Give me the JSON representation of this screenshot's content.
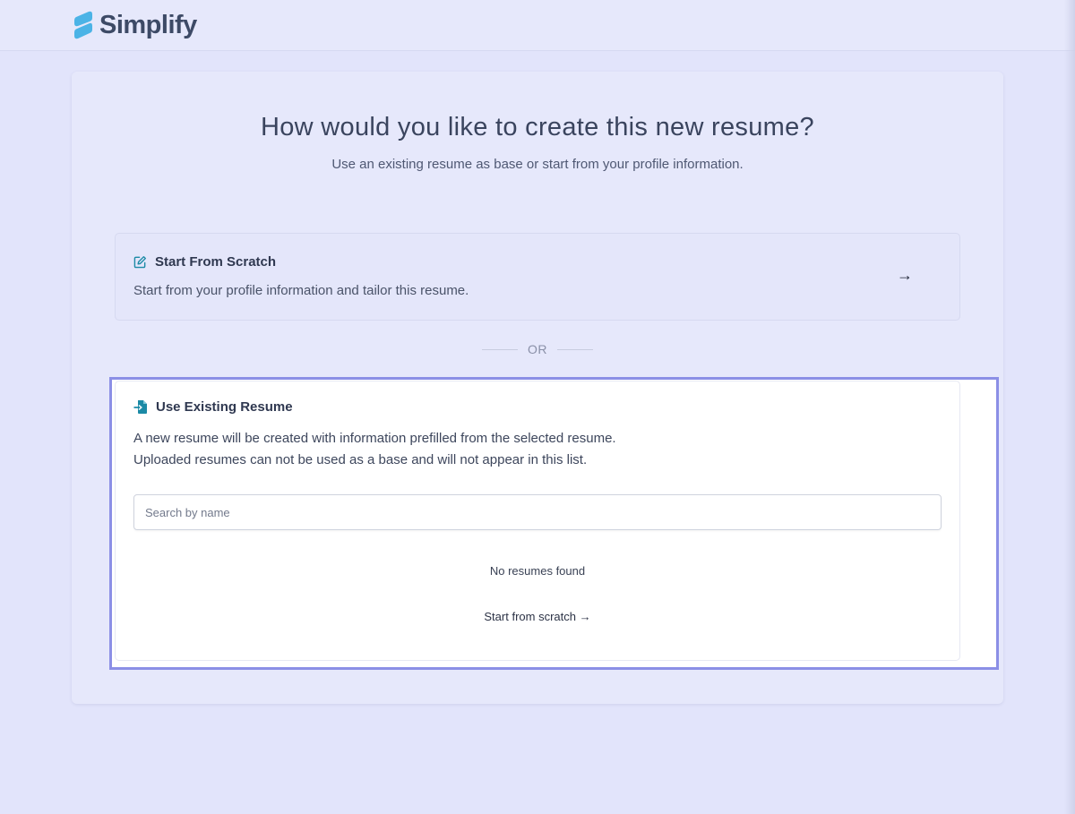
{
  "header": {
    "logo_text": "Simplify",
    "logo_icon": "simplify-logo-icon"
  },
  "page": {
    "title": "How would you like to create this new resume?",
    "subtitle": "Use an existing resume as base or start from your profile information."
  },
  "scratch_option": {
    "icon": "edit-icon",
    "title": "Start From Scratch",
    "description": "Start from your profile information and tailor this resume.",
    "arrow": "→"
  },
  "divider": {
    "text": "OR"
  },
  "existing_option": {
    "icon": "file-import-icon",
    "title": "Use Existing Resume",
    "description_line1": "A new resume will be created with information prefilled from the selected resume.",
    "description_line2": "Uploaded resumes can not be used as a base and will not appear in this list.",
    "search_placeholder": "Search by name",
    "search_value": "",
    "empty_message": "No resumes found",
    "scratch_link": "Start from scratch →"
  },
  "colors": {
    "background": "#e2e4fb",
    "accent_outline": "#8b8fe6",
    "logo_blue": "#4bb3e6",
    "icon_teal": "#1b8aa6"
  }
}
